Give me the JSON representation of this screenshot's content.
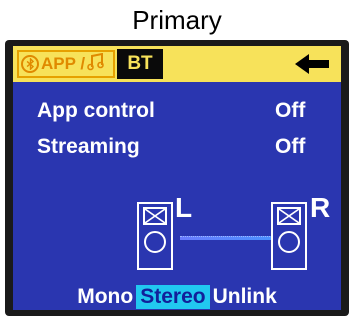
{
  "caption": "Primary",
  "topbar": {
    "mode_label": "APP / ",
    "bt_chip": "BT",
    "back_icon": "arrow-left-icon",
    "bluetooth_icon": "bluetooth-icon",
    "music_icon": "music-note-icon"
  },
  "settings": {
    "app_control": {
      "label": "App control",
      "value": "Off"
    },
    "streaming": {
      "label": "Streaming",
      "value": "Off"
    }
  },
  "speakers": {
    "left_label": "L",
    "right_label": "R"
  },
  "modes": {
    "mono": "Mono",
    "stereo": "Stereo",
    "unlink": "Unlink",
    "selected": "Stereo"
  },
  "colors": {
    "screen_bg": "#2a36b0",
    "topbar_bg": "#f7e25a",
    "accent_orange": "#e08a00",
    "selected_bg": "#21c8f0",
    "selected_text": "#12209a"
  }
}
